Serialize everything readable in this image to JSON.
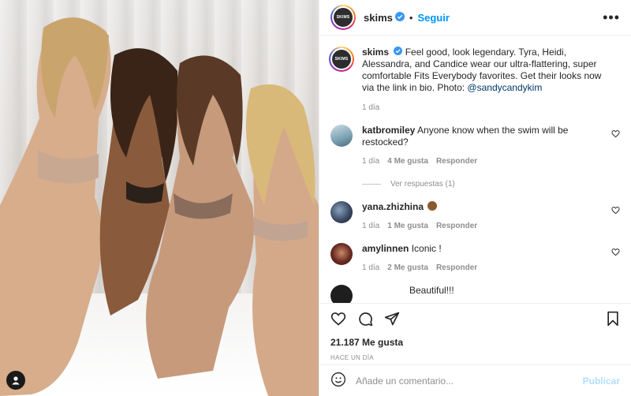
{
  "post": {
    "username": "skims",
    "logo_text": "SKIMS",
    "follow_label": "Seguir",
    "more_label": "•••",
    "caption": "Feel good, look legendary. Tyra, Heidi, Alessandra, and Candice wear our ultra-flattering, super comfortable Fits Everybody favorites. Get their looks now via the link in bio. Photo: ",
    "caption_mention": "@sandycandykim",
    "caption_time": "1 día",
    "likes": "21.187 Me gusta",
    "posted_ago": "HACE UN DÍA"
  },
  "comments": [
    {
      "username": "katbromiley",
      "text": "Anyone know when the swim will be restocked?",
      "time": "1 día",
      "likes": "4 Me gusta",
      "reply": "Responder",
      "view_replies": "Ver respuestas (1)",
      "avatar_color": "#7aa0b2"
    },
    {
      "username": "yana.zhizhina",
      "text": "",
      "time": "1 día",
      "likes": "1 Me gusta",
      "reply": "Responder",
      "avatar_color": "#3b4b63"
    },
    {
      "username": "amylinnen",
      "text": "Iconic !",
      "time": "1 día",
      "likes": "2 Me gusta",
      "reply": "Responder",
      "avatar_color": "#6a2b22"
    }
  ],
  "partial_comment": {
    "text": "Beautiful!!!"
  },
  "composer": {
    "placeholder": "Añade un comentario...",
    "publish_label": "Publicar"
  },
  "colors": {
    "accent": "#0095f6",
    "link": "#00376b",
    "muted": "#8e8e8e",
    "publish_disabled": "#b2dffc"
  }
}
